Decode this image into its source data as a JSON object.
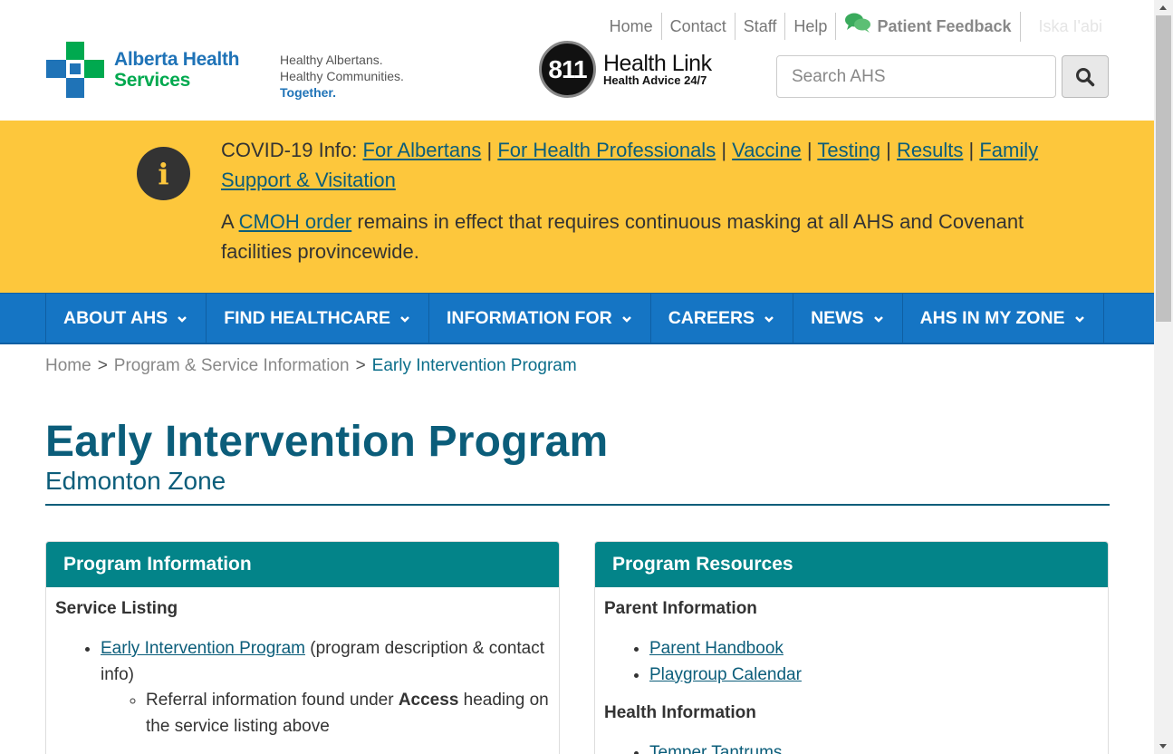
{
  "util_nav": {
    "items": [
      "Home",
      "Contact",
      "Staff",
      "Help"
    ],
    "feedback_label": "Patient Feedback",
    "language_label": "Iska I'abi"
  },
  "brand": {
    "logo_line1": "Alberta Health",
    "logo_line2": "Services",
    "tagline_line1": "Healthy Albertans.",
    "tagline_line2": "Healthy Communities.",
    "tagline_line3": "Together.",
    "healthlink_number": "811",
    "healthlink_title": "Health Link",
    "healthlink_subtitle": "Health Advice 24/7",
    "colors": {
      "blue": "#1f73b7",
      "green": "#00a94f"
    }
  },
  "search": {
    "placeholder": "Search AHS",
    "icon": "search-icon"
  },
  "alert": {
    "icon": "info-icon",
    "covid_prefix": "COVID-19 Info: ",
    "links": [
      "For Albertans",
      "For Health Professionals",
      "Vaccine",
      "Testing",
      "Results",
      "Family Support & Visitation"
    ],
    "separator": " | ",
    "masking_prefix": "A ",
    "masking_link": "CMOH order",
    "masking_text": " remains in effect that requires continuous masking at all AHS and Covenant facilities provincewide.",
    "background": "#fdc73c"
  },
  "main_nav": {
    "items": [
      "ABOUT AHS",
      "FIND HEALTHCARE",
      "INFORMATION FOR",
      "CAREERS",
      "NEWS",
      "AHS IN MY ZONE"
    ],
    "background": "#1575c4"
  },
  "breadcrumb": {
    "items": [
      "Home",
      "Program & Service Information"
    ],
    "separator": ">",
    "current": "Early Intervention Program"
  },
  "page": {
    "title": "Early Intervention Program",
    "subtitle": "Edmonton Zone",
    "accent": "#0b5d7a"
  },
  "program_information": {
    "heading": "Program Information",
    "section_title": "Service Listing",
    "item_link": "Early Intervention Program",
    "item_text": " (program description & contact info)",
    "sub_prefix": "Referral information found under ",
    "sub_bold": "Access",
    "sub_suffix": " heading on the service listing above",
    "header_color": "#038489"
  },
  "program_resources": {
    "heading": "Program Resources",
    "section1_title": "Parent Information",
    "section1_links": [
      "Parent Handbook",
      "Playgroup Calendar"
    ],
    "section2_title": "Health Information",
    "section2_links": [
      "Temper Tantrums"
    ]
  }
}
